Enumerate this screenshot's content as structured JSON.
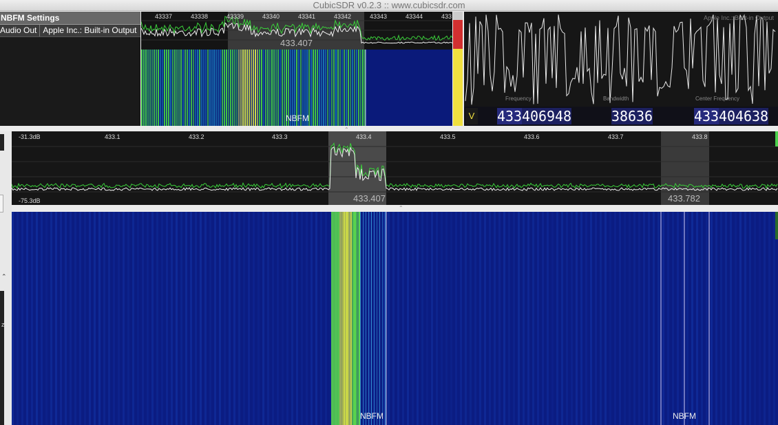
{
  "window": {
    "title": "CubicSDR v0.2.3 :: www.cubicsdr.com"
  },
  "settings": {
    "title": "NBFM Settings",
    "audio_out_label": "Audio Out",
    "audio_out_value": "Apple Inc.: Built-in Output"
  },
  "mini_spectrum": {
    "ticks": [
      "43337",
      "43338",
      "43339",
      "43340",
      "43341",
      "43342",
      "43343",
      "43344",
      "433"
    ],
    "center_freq": "433.407"
  },
  "mini_waterfall": {
    "mode_label": "NBFM"
  },
  "scope": {
    "corner_label": "Apple Inc.: Built-in Output",
    "captions": [
      "Frequency",
      "Bandwidth",
      "Center Frequency"
    ]
  },
  "freq_bar": {
    "v_label": "V",
    "frequency": "433406948",
    "bandwidth": "38636",
    "center_frequency": "433404638"
  },
  "main_spectrum": {
    "db_top": "-31.3dB",
    "db_bottom": "-75.3dB",
    "ticks": [
      "433.1",
      "433.2",
      "433.3",
      "433.4",
      "433.5",
      "433.6",
      "433.7",
      "433.8"
    ],
    "active_freq": "433.407",
    "secondary_freq": "433.782"
  },
  "main_waterfall": {
    "mode_label_1": "NBFM",
    "mode_label_2": "NBFM"
  },
  "colors": {
    "waterfall_bg": "#0b1c82",
    "signal_green": "#5ee04a",
    "signal_yellow": "#e4f040",
    "trace_white": "#f0f0f0",
    "trace_green": "#3ad03a",
    "meter_red": "#d23030",
    "meter_yellow": "#f0e040"
  }
}
